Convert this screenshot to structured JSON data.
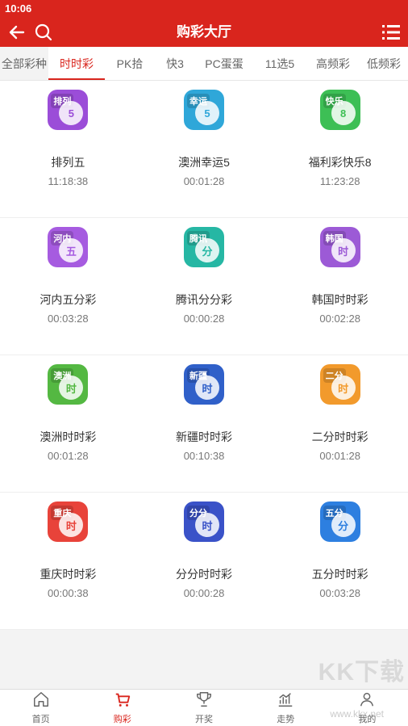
{
  "status": {
    "time": "10:06"
  },
  "header": {
    "title": "购彩大厅"
  },
  "tabs": [
    {
      "label": "全部彩种",
      "width": 60
    },
    {
      "label": "时时彩",
      "width": 70
    },
    {
      "label": "PK拾",
      "width": 62
    },
    {
      "label": "快3",
      "width": 50
    },
    {
      "label": "PC蛋蛋",
      "width": 72
    },
    {
      "label": "11选5",
      "width": 66
    },
    {
      "label": "高频彩",
      "width": 66
    },
    {
      "label": "低频彩",
      "width": 60
    }
  ],
  "lotteries": [
    {
      "name": "排列五",
      "time": "11:18:38",
      "tag": "排列",
      "ball": "5",
      "color": "#9b4dd8"
    },
    {
      "name": "澳洲幸运5",
      "time": "00:01:28",
      "tag": "幸运",
      "ball": "5",
      "color": "#2fa7d9"
    },
    {
      "name": "福利彩快乐8",
      "time": "11:23:28",
      "tag": "快乐",
      "ball": "8",
      "color": "#3dbf55"
    },
    {
      "name": "河内五分彩",
      "time": "00:03:28",
      "tag": "河内",
      "ball": "五",
      "color": "#a65be0"
    },
    {
      "name": "腾讯分分彩",
      "time": "00:00:28",
      "tag": "腾讯",
      "ball": "分",
      "color": "#26b7a4"
    },
    {
      "name": "韩国时时彩",
      "time": "00:02:28",
      "tag": "韩国",
      "ball": "时",
      "color": "#9c5ad6"
    },
    {
      "name": "澳洲时时彩",
      "time": "00:01:28",
      "tag": "澳洲",
      "ball": "时",
      "color": "#54b842"
    },
    {
      "name": "新疆时时彩",
      "time": "00:10:38",
      "tag": "新疆",
      "ball": "时",
      "color": "#3060c9"
    },
    {
      "name": "二分时时彩",
      "time": "00:01:28",
      "tag": "二分",
      "ball": "时",
      "color": "#f29a2c"
    },
    {
      "name": "重庆时时彩",
      "time": "00:00:38",
      "tag": "重庆",
      "ball": "时",
      "color": "#e8433a"
    },
    {
      "name": "分分时时彩",
      "time": "00:00:28",
      "tag": "分分",
      "ball": "时",
      "color": "#3a52c8"
    },
    {
      "name": "五分时时彩",
      "time": "00:03:28",
      "tag": "五分",
      "ball": "分",
      "color": "#2d7fe0"
    }
  ],
  "bottom_nav": [
    {
      "label": "首页",
      "icon": "home-icon"
    },
    {
      "label": "购彩",
      "icon": "cart-icon"
    },
    {
      "label": "开奖",
      "icon": "trophy-icon"
    },
    {
      "label": "走势",
      "icon": "trend-icon"
    },
    {
      "label": "我的",
      "icon": "user-icon"
    }
  ],
  "watermark": {
    "text": "KK下载",
    "url": "www.kkx.net"
  },
  "colors": {
    "primary": "#d9251d"
  }
}
